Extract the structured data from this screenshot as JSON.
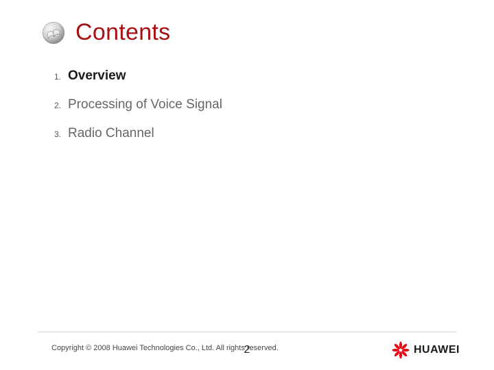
{
  "title": "Contents",
  "items": [
    {
      "number": "1.",
      "label": "Overview",
      "active": true
    },
    {
      "number": "2.",
      "label": "Processing of Voice Signal",
      "active": false
    },
    {
      "number": "3.",
      "label": "Radio Channel",
      "active": false
    }
  ],
  "footer": {
    "copyright": "Copyright © 2008 Huawei Technologies Co., Ltd. All rights reserved.",
    "page_number": "2",
    "brand": "HUAWEI"
  }
}
